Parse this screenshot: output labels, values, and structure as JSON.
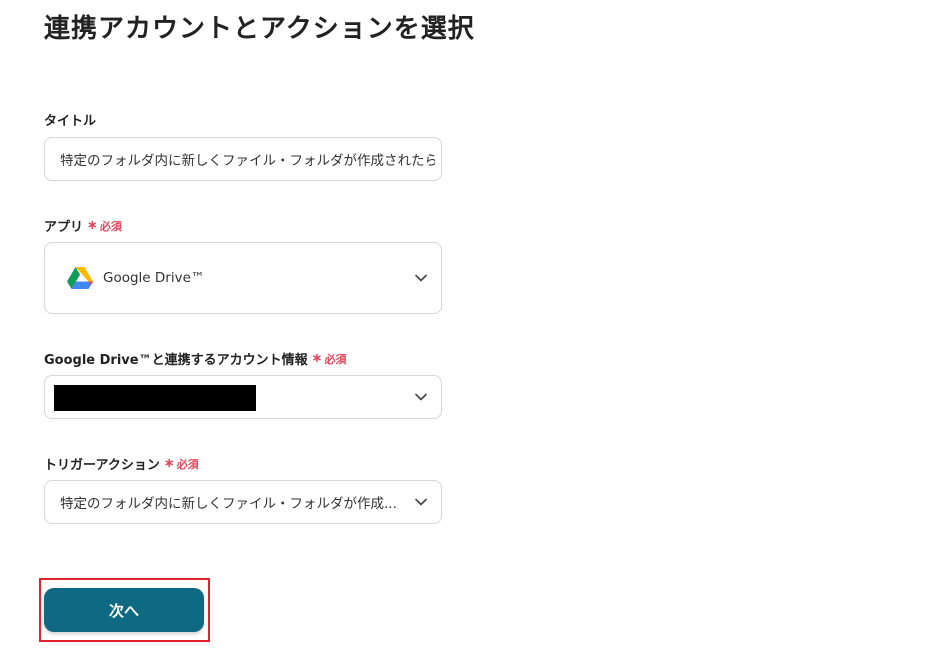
{
  "page": {
    "title": "連携アカウントとアクションを選択"
  },
  "fields": {
    "title_field": {
      "label": "タイトル",
      "value": "特定のフォルダ内に新しくファイル・フォルダが作成されたら"
    },
    "app_field": {
      "label": "アプリ",
      "required_label": "必須",
      "value": "Google Drive™",
      "icon": "google-drive-icon"
    },
    "account_field": {
      "label": "Google Drive™と連携するアカウント情報",
      "required_label": "必須",
      "value_redacted": true
    },
    "trigger_field": {
      "label": "トリガーアクション",
      "required_label": "必須",
      "value": "特定のフォルダ内に新しくファイル・フォルダが作成..."
    }
  },
  "actions": {
    "next_label": "次へ"
  },
  "colors": {
    "primary": "#0e6a82",
    "required": "#e2475a",
    "highlight": "#e0232f",
    "border": "#d4d6da"
  }
}
